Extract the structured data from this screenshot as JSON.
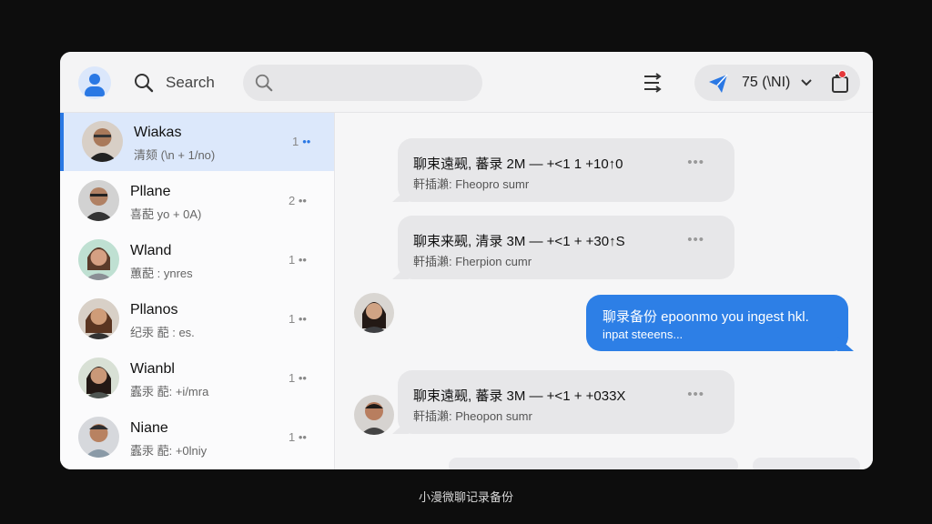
{
  "topbar": {
    "search_label": "Search",
    "search_placeholder": "",
    "status_text": "75 (\\NI)"
  },
  "contacts": [
    {
      "name": "Wiakas",
      "preview": "清颏 (\\n + 1/no)",
      "meta": "1",
      "active": true
    },
    {
      "name": "Pllane",
      "preview": "喜蓜 yo + 0A)",
      "meta": "2",
      "active": false
    },
    {
      "name": "Wland",
      "preview": "蕙蓜 : ynres",
      "meta": "1",
      "active": false
    },
    {
      "name": "Pllanos",
      "preview": "纪汞 蓜 : es.",
      "meta": "1",
      "active": false
    },
    {
      "name": "Wianbl",
      "preview": "蠹汞 蓜: +i/mra",
      "meta": "1",
      "active": false
    },
    {
      "name": "Niane",
      "preview": "蠹汞 蓜: +0lniy",
      "meta": "1",
      "active": false
    }
  ],
  "messages": [
    {
      "line1": "聊束遠觋, 蕃录 2M — +<1 1 +10↑0",
      "line2": "軒插瀨: Fheopro sumr"
    },
    {
      "line1": "聊束来觋, 清录 3M — +<1 + +30↑S",
      "line2": "軒插瀨: Fherpion cumr"
    },
    {
      "line1": "聊束遠觋, 蕃录 3M — +<1 + +033X",
      "line2": "軒插瀨: Pheopon sumr"
    }
  ],
  "outgoing": {
    "line1": "聊录备份 epoonmo you ingest hkl.",
    "line2": "inpat steeens..."
  },
  "caption": "小漫微聊记录备份",
  "colors": {
    "accent": "#2a78e4",
    "outgoing_bubble": "#2d7fe6",
    "badge": "#e5383b"
  }
}
